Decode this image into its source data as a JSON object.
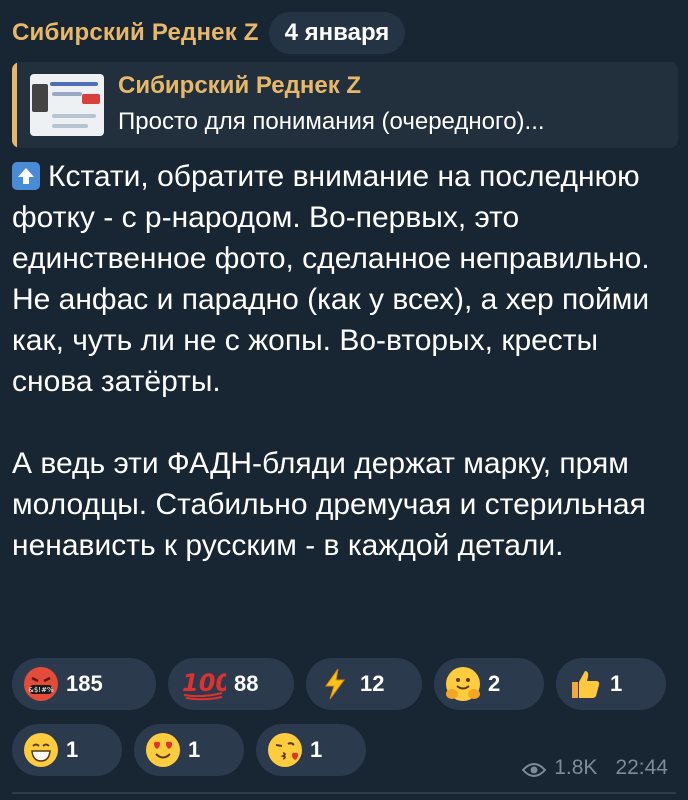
{
  "header": {
    "channel_name": "Сибирский Реднек Z",
    "date_chip": "4 января"
  },
  "reply": {
    "title": "Сибирский Реднек Z",
    "text": "Просто для понимания (очередного)..."
  },
  "message": {
    "icon": "up-arrow-icon",
    "text": "Кстати, обратите внимание на последнюю фотку - с р-народом. Во-первых, это единственное фото, сделанное неправильно. Не анфас и парадно (как у всех), а хер пойми как, чуть ли не с жопы. Во-вторых, кресты снова затёрты.\n\nА ведь эти ФАДН-бляди держат марку, прям молодцы. Стабильно дремучая и стерильная ненависть к русским - в каждой детали."
  },
  "reactions": [
    {
      "icon": "angry-swearing-face-icon",
      "count": "185"
    },
    {
      "icon": "hundred-points-icon",
      "count": "88"
    },
    {
      "icon": "lightning-bolt-icon",
      "count": "12"
    },
    {
      "icon": "hugging-face-icon",
      "count": "2"
    },
    {
      "icon": "thumbs-up-icon",
      "count": "1"
    },
    {
      "icon": "grinning-face-icon",
      "count": "1"
    },
    {
      "icon": "heart-eyes-face-icon",
      "count": "1"
    },
    {
      "icon": "kissing-heart-face-icon",
      "count": "1"
    }
  ],
  "meta": {
    "views": "1.8K",
    "time": "22:44"
  },
  "colors": {
    "background": "#182533",
    "accent": "#e8b86a",
    "chip": "#2b3a4c",
    "muted": "#7d8b99"
  }
}
